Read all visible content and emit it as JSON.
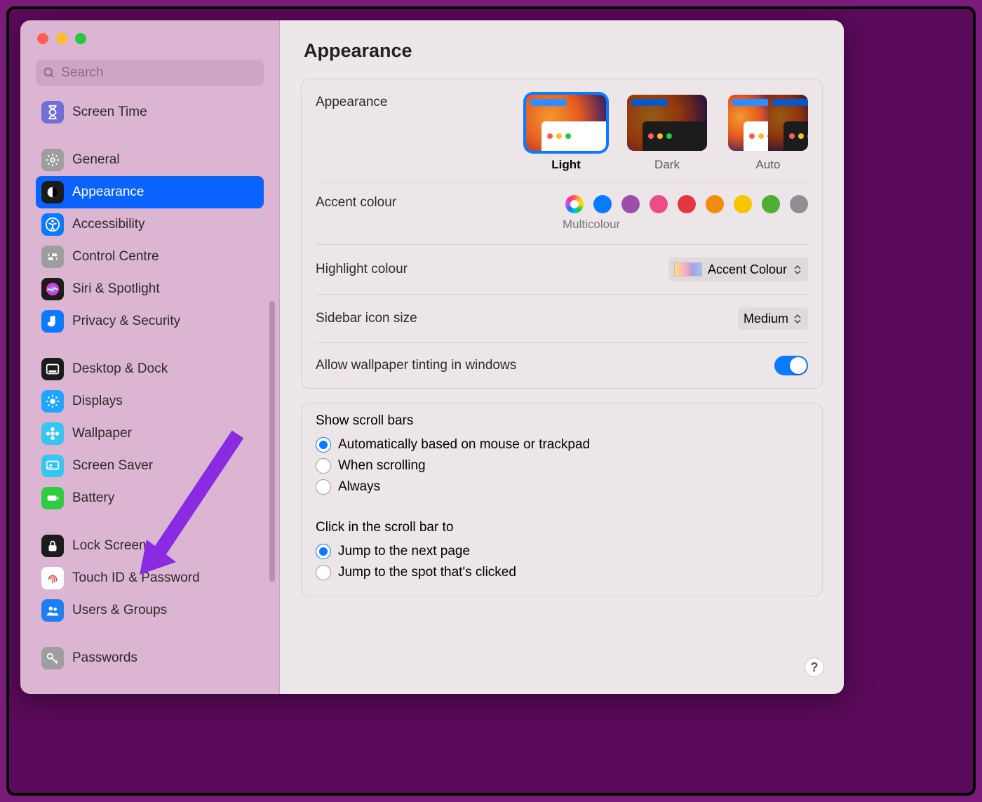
{
  "window": {
    "title": "Appearance"
  },
  "search": {
    "placeholder": "Search"
  },
  "sidebar": {
    "items": [
      {
        "label": "Screen Time",
        "icon": "hourglass",
        "bg": "#6f6fd7"
      },
      {
        "gap": true
      },
      {
        "label": "General",
        "icon": "gear",
        "bg": "#9e9e9e"
      },
      {
        "label": "Appearance",
        "icon": "appearance",
        "bg": "#1c1c1c",
        "selected": true
      },
      {
        "label": "Accessibility",
        "icon": "accessibility",
        "bg": "#0a7aff"
      },
      {
        "label": "Control Centre",
        "icon": "sliders",
        "bg": "#9e9e9e"
      },
      {
        "label": "Siri & Spotlight",
        "icon": "siri",
        "bg": "#1c1c1c"
      },
      {
        "label": "Privacy & Security",
        "icon": "hand",
        "bg": "#0a7aff"
      },
      {
        "gap": true
      },
      {
        "label": "Desktop & Dock",
        "icon": "dock",
        "bg": "#1c1c1c"
      },
      {
        "label": "Displays",
        "icon": "sun",
        "bg": "#1fa7ff"
      },
      {
        "label": "Wallpaper",
        "icon": "flower",
        "bg": "#35c7f2"
      },
      {
        "label": "Screen Saver",
        "icon": "screensaver",
        "bg": "#35c7f2"
      },
      {
        "label": "Battery",
        "icon": "battery",
        "bg": "#2ecc40"
      },
      {
        "gap": true
      },
      {
        "label": "Lock Screen",
        "icon": "lock",
        "bg": "#1c1c1c"
      },
      {
        "label": "Touch ID & Password",
        "icon": "fingerprint",
        "bg": "#ffffff"
      },
      {
        "label": "Users & Groups",
        "icon": "users",
        "bg": "#1f7ef0"
      },
      {
        "gap": true
      },
      {
        "label": "Passwords",
        "icon": "key",
        "bg": "#9e9e9e"
      }
    ]
  },
  "appearance": {
    "section_label": "Appearance",
    "modes": [
      {
        "label": "Light",
        "selected": true
      },
      {
        "label": "Dark"
      },
      {
        "label": "Auto"
      }
    ],
    "accent": {
      "label": "Accent colour",
      "selected_label": "Multicolour",
      "colours": [
        {
          "name": "multicolour",
          "multi": true,
          "selected": true
        },
        {
          "name": "blue",
          "hex": "#0a7aff"
        },
        {
          "name": "purple",
          "hex": "#9a4fa8"
        },
        {
          "name": "pink",
          "hex": "#e94e8a"
        },
        {
          "name": "red",
          "hex": "#e0383e"
        },
        {
          "name": "orange",
          "hex": "#f08c0f"
        },
        {
          "name": "yellow",
          "hex": "#f7c500"
        },
        {
          "name": "green",
          "hex": "#4fae33"
        },
        {
          "name": "graphite",
          "hex": "#8e8e93"
        }
      ]
    },
    "highlight": {
      "label": "Highlight colour",
      "value": "Accent Colour"
    },
    "sidebar_icon": {
      "label": "Sidebar icon size",
      "value": "Medium"
    },
    "tinting": {
      "label": "Allow wallpaper tinting in windows",
      "on": true
    }
  },
  "scroll": {
    "show_label": "Show scroll bars",
    "show_options": [
      {
        "label": "Automatically based on mouse or trackpad",
        "selected": true
      },
      {
        "label": "When scrolling"
      },
      {
        "label": "Always"
      }
    ],
    "click_label": "Click in the scroll bar to",
    "click_options": [
      {
        "label": "Jump to the next page",
        "selected": true
      },
      {
        "label": "Jump to the spot that's clicked"
      }
    ]
  },
  "help": {
    "label": "?"
  }
}
